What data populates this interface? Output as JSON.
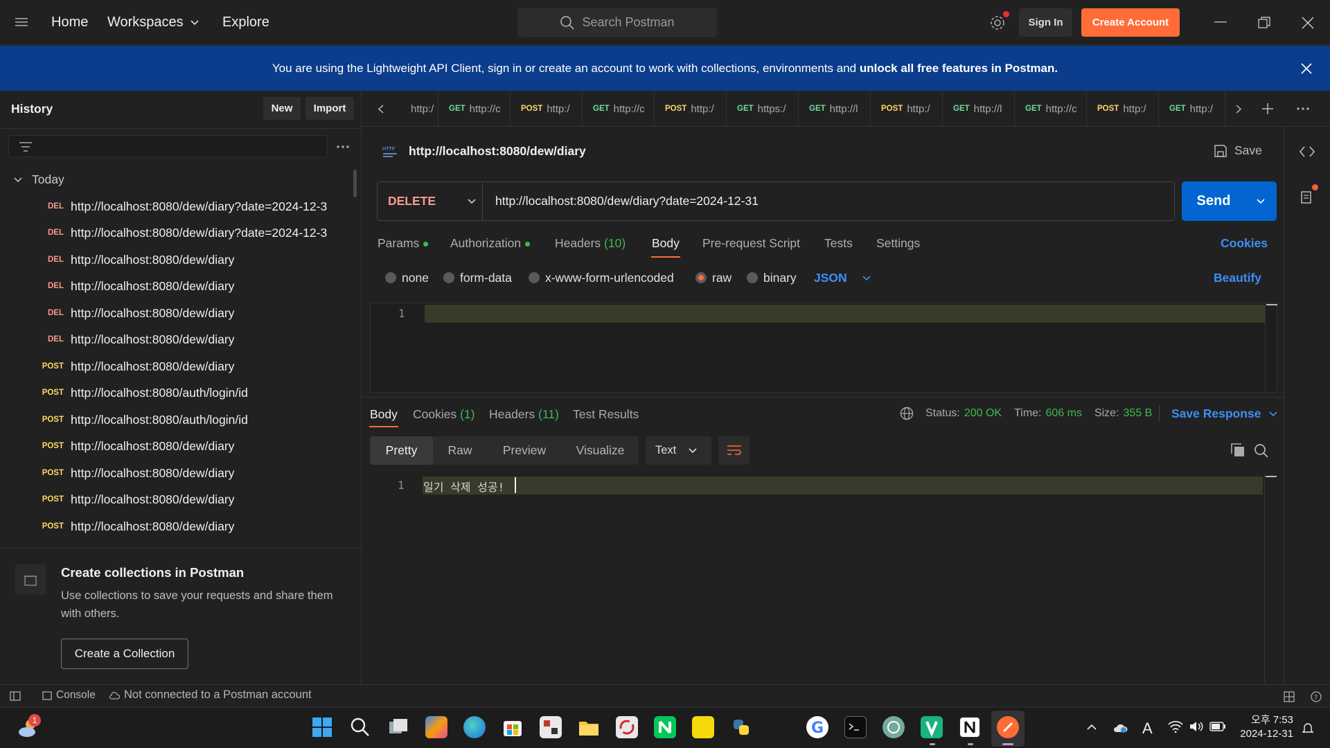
{
  "topbar": {
    "nav": [
      "Home",
      "Workspaces",
      "Explore"
    ],
    "search_placeholder": "Search Postman",
    "sign_in": "Sign In",
    "create_account": "Create Account"
  },
  "banner": {
    "text": "You are using the Lightweight API Client, sign in or create an account to work with collections, environments and ",
    "bold": "unlock all free features in Postman."
  },
  "sidebar": {
    "title": "History",
    "new_label": "New",
    "import_label": "Import",
    "group_label": "Today",
    "items": [
      {
        "method": "DEL",
        "url": "http://localhost:8080/dew/diary?date=2024-12-3"
      },
      {
        "method": "DEL",
        "url": "http://localhost:8080/dew/diary?date=2024-12-3"
      },
      {
        "method": "DEL",
        "url": "http://localhost:8080/dew/diary"
      },
      {
        "method": "DEL",
        "url": "http://localhost:8080/dew/diary"
      },
      {
        "method": "DEL",
        "url": "http://localhost:8080/dew/diary"
      },
      {
        "method": "DEL",
        "url": "http://localhost:8080/dew/diary"
      },
      {
        "method": "POST",
        "url": "http://localhost:8080/dew/diary"
      },
      {
        "method": "POST",
        "url": "http://localhost:8080/auth/login/id"
      },
      {
        "method": "POST",
        "url": "http://localhost:8080/auth/login/id"
      },
      {
        "method": "POST",
        "url": "http://localhost:8080/dew/diary"
      },
      {
        "method": "POST",
        "url": "http://localhost:8080/dew/diary"
      },
      {
        "method": "POST",
        "url": "http://localhost:8080/dew/diary"
      },
      {
        "method": "POST",
        "url": "http://localhost:8080/dew/diary"
      }
    ],
    "promo_title": "Create collections in Postman",
    "promo_text": "Use collections to save your requests and share them with others.",
    "promo_button": "Create a Collection"
  },
  "tabs": [
    {
      "method": "",
      "label": "http:/"
    },
    {
      "method": "GET",
      "label": "http://c"
    },
    {
      "method": "POST",
      "label": "http:/"
    },
    {
      "method": "GET",
      "label": "http://c"
    },
    {
      "method": "POST",
      "label": "http:/"
    },
    {
      "method": "GET",
      "label": "https:/"
    },
    {
      "method": "GET",
      "label": "http://l"
    },
    {
      "method": "POST",
      "label": "http:/"
    },
    {
      "method": "GET",
      "label": "http://l"
    },
    {
      "method": "GET",
      "label": "http://c"
    },
    {
      "method": "POST",
      "label": "http:/"
    },
    {
      "method": "GET",
      "label": "http:/"
    }
  ],
  "request": {
    "title": "http://localhost:8080/dew/diary",
    "save_label": "Save",
    "method": "DELETE",
    "url": "http://localhost:8080/dew/diary?date=2024-12-31",
    "send_label": "Send",
    "subtabs": {
      "params": "Params",
      "authorization": "Authorization",
      "headers": "Headers",
      "headers_count": "(10)",
      "body": "Body",
      "prerequest": "Pre-request Script",
      "tests": "Tests",
      "settings": "Settings",
      "cookies": "Cookies"
    },
    "body_types": {
      "none": "none",
      "form_data": "form-data",
      "urlencoded": "x-www-form-urlencoded",
      "raw": "raw",
      "binary": "binary",
      "format": "JSON",
      "beautify": "Beautify"
    },
    "editor_line": "1"
  },
  "response": {
    "tabs": {
      "body": "Body",
      "cookies": "Cookies",
      "cookies_count": "(1)",
      "headers": "Headers",
      "headers_count": "(11)",
      "test_results": "Test Results"
    },
    "status_label": "Status:",
    "status_value": "200 OK",
    "time_label": "Time:",
    "time_value": "606 ms",
    "size_label": "Size:",
    "size_value": "355 B",
    "save_response": "Save Response",
    "view_modes": [
      "Pretty",
      "Raw",
      "Preview",
      "Visualize"
    ],
    "format": "Text",
    "line_number": "1",
    "body_text": "일기 삭제 성공!"
  },
  "statusbar": {
    "console": "Console",
    "connection": "Not connected to a Postman account"
  },
  "taskbar": {
    "notification_count": "1",
    "time": "오후 7:53",
    "date": "2024-12-31",
    "ime": "A"
  },
  "colors": {
    "accent": "#ff6c37",
    "primary_blue": "#0265d2",
    "link_blue": "#3d8ff5",
    "banner": "#0b3d8c",
    "success": "#3fb950"
  }
}
